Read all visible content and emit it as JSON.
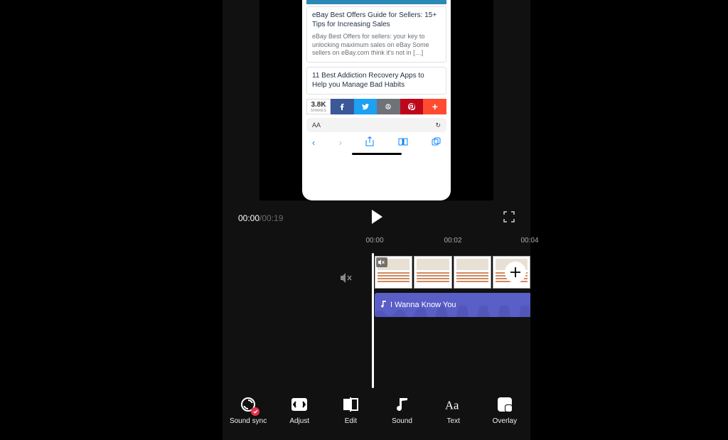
{
  "preview": {
    "article1": {
      "title": "eBay Best Offers Guide for Sellers: 15+ Tips for Increasing Sales",
      "excerpt": "eBay Best Offers for sellers: your key to unlocking maximum sales on eBay Some sellers on eBay.com think it's not in […]"
    },
    "article2": {
      "title": "11 Best Addiction Recovery Apps to Help you Manage Bad Habits"
    },
    "share": {
      "count": "3.8K",
      "label": "SHARES",
      "plus": "+"
    },
    "urlbar": {
      "aa": "AA",
      "refresh": "↻"
    }
  },
  "transport": {
    "current": "00:00",
    "sep": "/",
    "duration": "00:19"
  },
  "ruler": {
    "t0": "00:00",
    "t1": "00:02",
    "t2": "00:04"
  },
  "audio": {
    "label": "I Wanna Know You"
  },
  "toolbar": {
    "soundsync": "Sound sync",
    "adjust": "Adjust",
    "edit": "Edit",
    "sound": "Sound",
    "text": "Text",
    "overlay": "Overlay"
  }
}
